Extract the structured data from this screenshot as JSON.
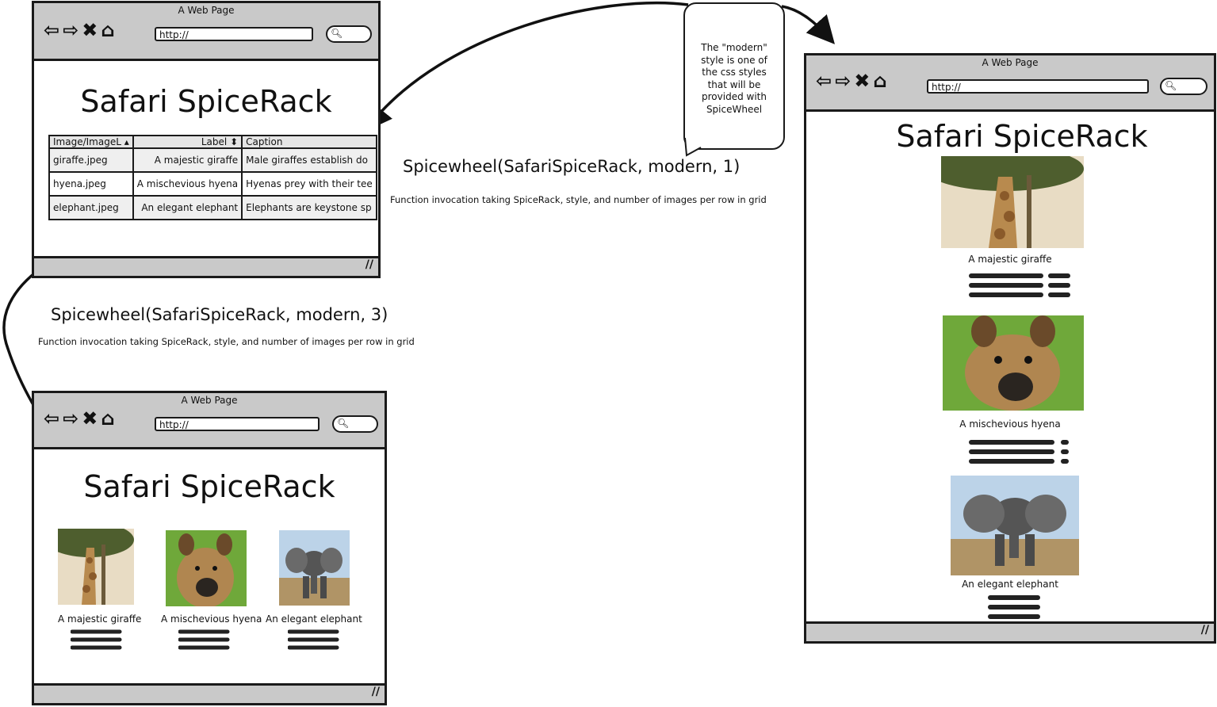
{
  "browser": {
    "title": "A Web Page",
    "url": "http://",
    "nav_glyphs": "⇦⇨✖⌂",
    "search_glyph": "🔍︎",
    "resize_glyph": "//"
  },
  "page_title": "Safari SpiceRack",
  "data_table": {
    "headers": [
      "Image/ImageL ▴",
      "Label ⬍",
      "Caption"
    ],
    "rows": [
      {
        "image": "giraffe.jpeg",
        "label": "A majestic giraffe",
        "caption": "Male giraffes establish do"
      },
      {
        "image": "hyena.jpeg",
        "label": "A mischevious hyena",
        "caption": "Hyenas prey with their tee"
      },
      {
        "image": "elephant.jpeg",
        "label": "An elegant elephant",
        "caption": "Elephants are keystone sp"
      }
    ]
  },
  "captions": [
    "A majestic giraffe",
    "A mischevious hyena",
    "An elegant elephant"
  ],
  "invocation_one_per_row": {
    "code": "Spicewheel(SafariSpiceRack, modern, 1)",
    "description": "Function invocation taking SpiceRack, style, and number of images per row in grid"
  },
  "invocation_three_per_row": {
    "code": "Spicewheel(SafariSpiceRack, modern, 3)",
    "description": "Function invocation taking SpiceRack, style, and number of images per row in grid"
  },
  "callout": {
    "lines": [
      "The \"modern\"",
      "style is one of",
      "the css styles",
      "that will be",
      "provided with",
      "SpiceWheel"
    ]
  },
  "animal_icons": [
    "giraffe-photo",
    "hyena-photo",
    "elephant-photo"
  ]
}
